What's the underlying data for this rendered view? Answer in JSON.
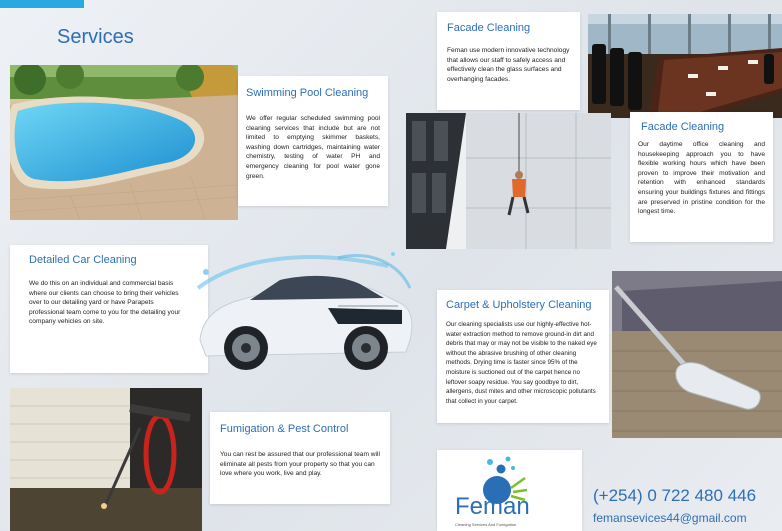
{
  "page_title": "Services",
  "sections": {
    "pool": {
      "title": "Swimming Pool Cleaning",
      "body": "We offer regular scheduled swimming pool cleaning services that include but are not limited to emptying skimmer baskets, washing down cartridges, maintaining water chemistry, testing of water PH and emergency cleaning for pool water gone green."
    },
    "facade_top": {
      "title": "Facade Cleaning",
      "body": "Feman use modern innovative technology that allows our staff to safely access and effectively clean the glass surfaces and overhanging facades."
    },
    "facade_office": {
      "title": "Facade Cleaning",
      "body": "Our daytime office cleaning and housekeeping approach you to have flexible working hours which have been proven to improve their motivation and retention with enhanced standards ensuring your buildings fixtures and fittings are preserved in pristine condition for the longest time."
    },
    "car": {
      "title": "Detailed Car Cleaning",
      "body": "We do this on an individual and commercial basis where our clients can choose to bring their vehicles over to our detailing yard or have Parapets professional team come to you for the detailing your company vehicles on site."
    },
    "carpet": {
      "title": "Carpet & Upholstery Cleaning",
      "body": "Our cleaning specialists use our highly-effective hot-water extraction method to remove ground-in dirt and debris that may or may not be visible to the naked eye without the abrasive brushing of other cleaning methods. Drying time is faster since 95% of the moisture is suctioned out of the carpet hence no leftover soapy residue. You say goodbye to dirt, allergens, dust mites and other microscopic pollutants that collect in your carpet."
    },
    "fumigation": {
      "title": "Fumigation & Pest Control",
      "body": "You can rest be assured that our professional team will eliminate all pests from your property so that you can love where you work, live and play."
    }
  },
  "logo": {
    "name": "Feman",
    "tagline": "Cleaning Services And Fumigation"
  },
  "contact": {
    "phone": "(+254) 0 722 480 446",
    "email": "femansevices44@gmail.com"
  },
  "colors": {
    "accent": "#2d6fb5",
    "corner": "#29a9e0",
    "logo_green": "#7bbf2a"
  }
}
